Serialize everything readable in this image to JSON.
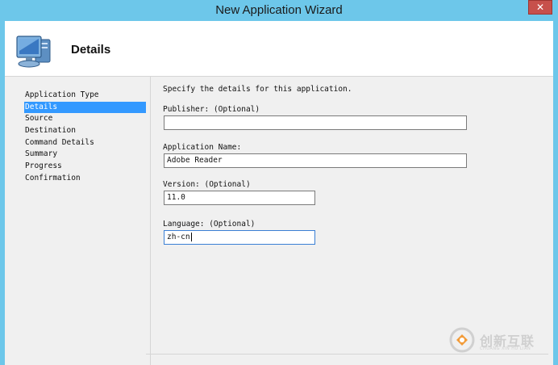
{
  "window": {
    "title": "New Application Wizard",
    "close_label": "✕"
  },
  "header": {
    "title": "Details",
    "icon": "computer-icon"
  },
  "nav": {
    "items": [
      {
        "label": "Application Type"
      },
      {
        "label": "Details"
      },
      {
        "label": "Source"
      },
      {
        "label": "Destination"
      },
      {
        "label": "Command Details"
      },
      {
        "label": "Summary"
      },
      {
        "label": "Progress"
      },
      {
        "label": "Confirmation"
      }
    ],
    "active_index": 1
  },
  "form": {
    "intro": "Specify the details for this application.",
    "publisher": {
      "label": "Publisher:  (Optional)",
      "value": ""
    },
    "app_name": {
      "label": "Application Name:",
      "value": "Adobe Reader"
    },
    "version": {
      "label": "Version:  (Optional)",
      "value": "11.0"
    },
    "language": {
      "label": "Language:  (Optional)",
      "value": "zh-cn"
    }
  },
  "watermark": {
    "text": "创新互联",
    "subtext": "CHUANG XIN HU LIAN",
    "icon": "brand-logo-icon"
  }
}
